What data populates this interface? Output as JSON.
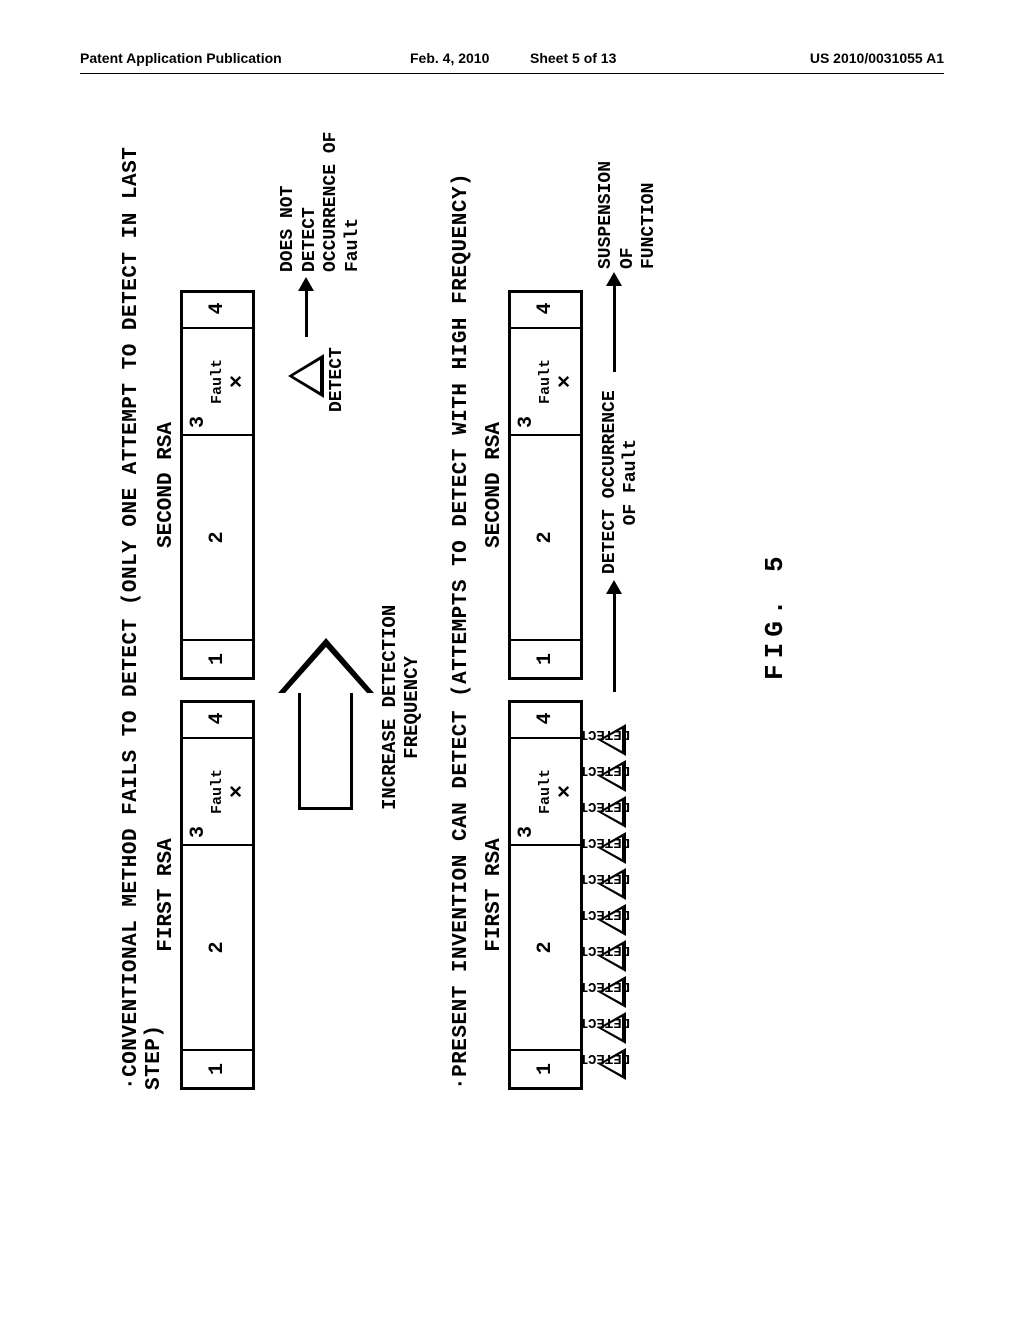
{
  "header": {
    "left": "Patent Application Publication",
    "date": "Feb. 4, 2010",
    "sheet": "Sheet 5 of 13",
    "pubno": "US 2010/0031055 A1"
  },
  "section1": {
    "title": "·CONVENTIONAL METHOD FAILS TO DETECT (ONLY ONE ATTEMPT TO DETECT IN LAST STEP)",
    "first_rsa": "FIRST RSA",
    "second_rsa": "SECOND RSA",
    "steps": [
      "1",
      "2",
      "3",
      "4"
    ],
    "fault": "Fault",
    "fault_x": "×",
    "detect": "DETECT",
    "result_l1": "DOES NOT DETECT",
    "result_l2": "OCCURRENCE OF Fault"
  },
  "arrow_label_l1": "INCREASE DETECTION",
  "arrow_label_l2": "FREQUENCY",
  "section2": {
    "title": "·PRESENT INVENTION CAN DETECT (ATTEMPTS TO DETECT WITH HIGH FREQUENCY)",
    "first_rsa": "FIRST RSA",
    "second_rsa": "SECOND RSA",
    "steps": [
      "1",
      "2",
      "3",
      "4"
    ],
    "fault": "Fault",
    "fault_x": "×",
    "detect": "DETECT",
    "detect_count": 10,
    "occ_l1": "DETECT OCCURRENCE",
    "occ_l2": "OF Fault",
    "result_l1": "SUSPENSION OF",
    "result_l2": "FUNCTION"
  },
  "figure_label": "FIG. 5",
  "chart_data": {
    "type": "table",
    "description": "Comparison diagram: conventional single-detection RSA flow vs present-invention high-frequency detection RSA flow",
    "conventional": {
      "rsa_passes": 2,
      "steps_per_pass": 4,
      "fault_at_step": 3,
      "detections": 1,
      "detects_fault": false
    },
    "present_invention": {
      "rsa_passes": 2,
      "steps_per_pass": 4,
      "fault_at_step": 3,
      "detections": 10,
      "detects_fault": true,
      "outcome": "SUSPENSION OF FUNCTION"
    }
  }
}
